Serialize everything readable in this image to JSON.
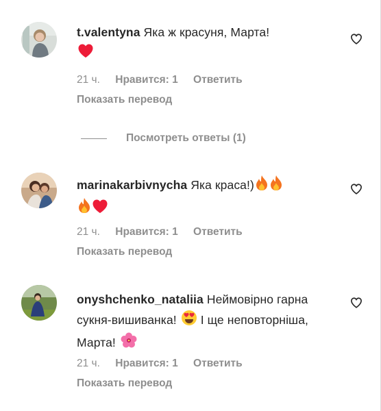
{
  "comments": [
    {
      "username": "t.valentyna",
      "text": "Яка ж красуня, Марта!",
      "emojis": [
        "red-heart"
      ],
      "time": "21 ч.",
      "likes": "Нравится: 1",
      "reply": "Ответить",
      "translate": "Показать перевод"
    },
    {
      "username": "marinakarbivnycha",
      "text": "Яка краса!)",
      "emojis": [
        "fire",
        "fire",
        "fire",
        "red-heart"
      ],
      "time": "21 ч.",
      "likes": "Нравится: 1",
      "reply": "Ответить",
      "translate": "Показать перевод"
    },
    {
      "username": "onyshchenko_nataliia",
      "text": "Неймовірно гарна сукня-вишиванка!",
      "text2": "І ще неповторніша, Марта!",
      "emojis": [
        "heart-eyes",
        "hibiscus"
      ],
      "time": "21 ч.",
      "likes": "Нравится: 1",
      "reply": "Ответить",
      "translate": "Показать перевод"
    }
  ],
  "view_replies": "Посмотреть ответы (1)",
  "colors": {
    "text": "#262626",
    "secondary": "#8e8e8e",
    "heart": "#ed1c38",
    "fire": "#f4731f"
  }
}
